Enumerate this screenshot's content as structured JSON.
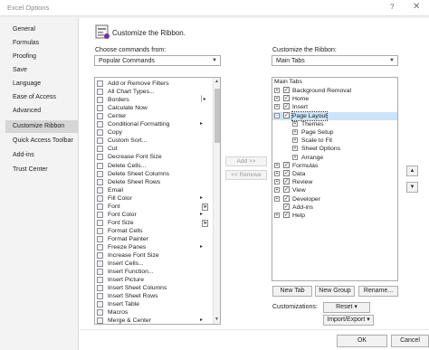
{
  "window": {
    "title": "Excel Options",
    "help": "?",
    "close": "✕"
  },
  "nav": {
    "items": [
      {
        "label": "General"
      },
      {
        "label": "Formulas"
      },
      {
        "label": "Proofing"
      },
      {
        "label": "Save"
      },
      {
        "label": "Language"
      },
      {
        "label": "Ease of Access"
      },
      {
        "label": "Advanced"
      },
      {
        "label": "Customize Ribbon",
        "active": true
      },
      {
        "label": "Quick Access Toolbar"
      },
      {
        "label": "Add-ins"
      },
      {
        "label": "Trust Center"
      }
    ]
  },
  "header": {
    "title": "Customize the Ribbon."
  },
  "left": {
    "label": "Choose commands from:",
    "dropdown_value": "Popular Commands",
    "commands": [
      {
        "label": "Add or Remove Filters"
      },
      {
        "label": "All Chart Types..."
      },
      {
        "label": "Borders",
        "sub": "│▸"
      },
      {
        "label": "Calculate Now"
      },
      {
        "label": "Center"
      },
      {
        "label": "Conditional Formatting",
        "sub": "▸"
      },
      {
        "label": "Copy"
      },
      {
        "label": "Custom Sort..."
      },
      {
        "label": "Cut"
      },
      {
        "label": "Decrease Font Size"
      },
      {
        "label": "Delete Cells..."
      },
      {
        "label": "Delete Sheet Columns"
      },
      {
        "label": "Delete Sheet Rows"
      },
      {
        "label": "Email"
      },
      {
        "label": "Fill Color",
        "sub": "▸"
      },
      {
        "label": "Font",
        "box": "I▾"
      },
      {
        "label": "Font Color",
        "sub": "▸"
      },
      {
        "label": "Font Size",
        "box": "I▾"
      },
      {
        "label": "Format Cells"
      },
      {
        "label": "Format Painter"
      },
      {
        "label": "Freeze Panes",
        "sub": "▸"
      },
      {
        "label": "Increase Font Size"
      },
      {
        "label": "Insert Cells..."
      },
      {
        "label": "Insert Function..."
      },
      {
        "label": "Insert Picture"
      },
      {
        "label": "Insert Sheet Columns"
      },
      {
        "label": "Insert Sheet Rows"
      },
      {
        "label": "Insert Table"
      },
      {
        "label": "Macros"
      },
      {
        "label": "Merge & Center",
        "sub": "▸"
      }
    ]
  },
  "middle": {
    "add": "Add >>",
    "remove": "<< Remove"
  },
  "right": {
    "label": "Customize the Ribbon:",
    "dropdown_value": "Main Tabs",
    "group_header": "Main Tabs",
    "tree": [
      {
        "label": "Background Removal",
        "level": 0,
        "exp": "+",
        "checked": true
      },
      {
        "label": "Home",
        "level": 0,
        "exp": "+",
        "checked": true
      },
      {
        "label": "Insert",
        "level": 0,
        "exp": "+",
        "checked": true
      },
      {
        "label": "Page Layout",
        "level": 0,
        "exp": "−",
        "checked": true,
        "selected": true
      },
      {
        "label": "Themes",
        "level": 1,
        "exp": "+"
      },
      {
        "label": "Page Setup",
        "level": 1,
        "exp": "+"
      },
      {
        "label": "Scale to Fit",
        "level": 1,
        "exp": "+"
      },
      {
        "label": "Sheet Options",
        "level": 1,
        "exp": "+"
      },
      {
        "label": "Arrange",
        "level": 1,
        "exp": "+"
      },
      {
        "label": "Formulas",
        "level": 0,
        "exp": "+",
        "checked": true
      },
      {
        "label": "Data",
        "level": 0,
        "exp": "+",
        "checked": true
      },
      {
        "label": "Review",
        "level": 0,
        "exp": "+",
        "checked": true
      },
      {
        "label": "View",
        "level": 0,
        "exp": "+",
        "checked": true
      },
      {
        "label": "Developer",
        "level": 0,
        "exp": "+",
        "checked": true
      },
      {
        "label": "Add-ins",
        "level": 0,
        "exp": "",
        "checked": true
      },
      {
        "label": "Help",
        "level": 0,
        "exp": "+",
        "checked": true
      }
    ],
    "new_tab": "New Tab",
    "new_group": "New Group",
    "rename": "Rename...",
    "customizations_label": "Customizations:",
    "reset": "Reset ▾",
    "import_export": "Import/Export ▾",
    "up": "▲",
    "down": "▼"
  },
  "footer": {
    "ok": "OK",
    "cancel": "Cancel"
  }
}
